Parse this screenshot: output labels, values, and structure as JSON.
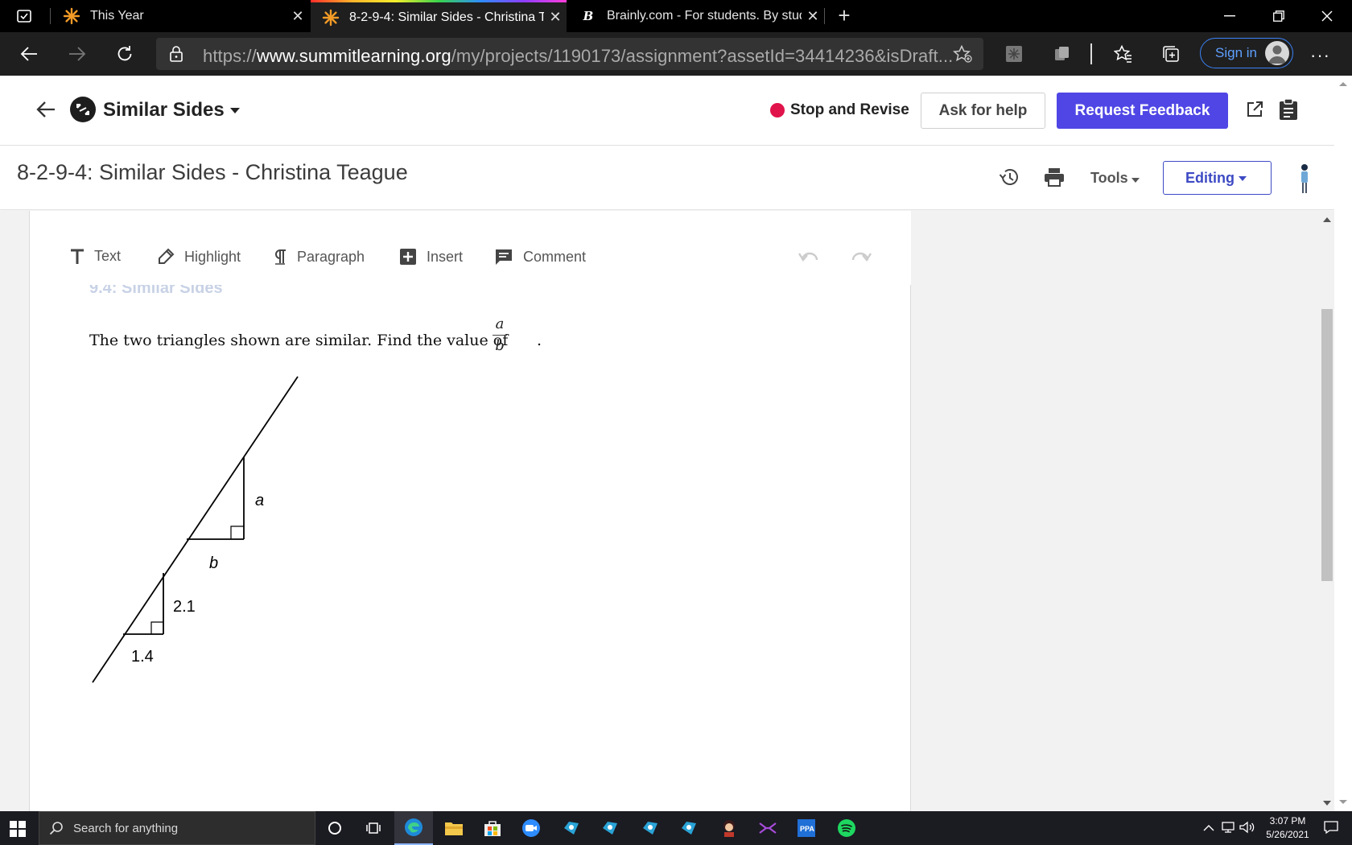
{
  "browser": {
    "tabs": [
      {
        "title": "This Year",
        "active": false
      },
      {
        "title": "8-2-9-4: Similar Sides - Christina Teague",
        "active": true
      },
      {
        "title": "Brainly.com - For students. By students.",
        "active": false
      }
    ],
    "url_scheme": "https://",
    "url_host": "www.summitlearning.org",
    "url_path": "/my/projects/1190173/assignment?assetId=34414236&isDraft...",
    "sign_in_label": "Sign in",
    "accent_color": "#3b82f6"
  },
  "app": {
    "project_title": "Similar Sides",
    "status_label": "Stop and Revise",
    "status_color": "#e0134a",
    "ask_help_label": "Ask for help",
    "request_feedback_label": "Request Feedback",
    "primary_color": "#4f46e5"
  },
  "doc": {
    "title": "8-2-9-4: Similar Sides - Christina Teague",
    "tools_label": "Tools",
    "editing_label": "Editing",
    "toolbar": {
      "text_label": "Text",
      "highlight_label": "Highlight",
      "paragraph_label": "Paragraph",
      "insert_label": "Insert",
      "comment_label": "Comment"
    },
    "faded_heading": "9.4: Similar Sides",
    "question": "The two triangles shown are similar. Find the value of",
    "fraction_numerator": "a",
    "fraction_denominator": "b",
    "figure": {
      "big_triangle_vertical_label": "a",
      "big_triangle_horizontal_label": "b",
      "small_triangle_vertical_label": "2.1",
      "small_triangle_horizontal_label": "1.4"
    }
  },
  "taskbar": {
    "search_placeholder": "Search for anything",
    "time": "3:07 PM",
    "date": "5/26/2021"
  }
}
